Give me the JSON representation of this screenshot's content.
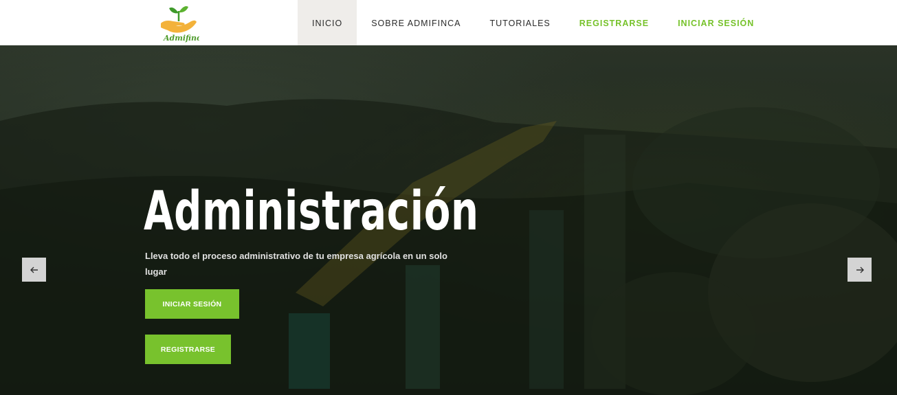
{
  "brand": {
    "logo_text": "Admifinca",
    "logo_colors": {
      "leaf": "#3f9a2b",
      "hand": "#f3b23a"
    }
  },
  "nav": {
    "items": [
      {
        "label": "INICIO",
        "active": true
      },
      {
        "label": "SOBRE ADMIFINCA"
      },
      {
        "label": "TUTORIALES"
      },
      {
        "label": "REGISTRARSE",
        "accent": true
      },
      {
        "label": "INICIAR SESIÓN",
        "accent": true
      }
    ]
  },
  "hero": {
    "title": "Administración",
    "subtitle": "Lleva todo el proceso administrativo de tu empresa agrícola en un solo lugar",
    "buttons": {
      "login": "INICIAR SESIÓN",
      "register": "REGISTRARSE"
    },
    "prev_icon": "arrow-left-icon",
    "next_icon": "arrow-right-icon"
  },
  "colors": {
    "accent": "#78c22d",
    "nav_text": "#2a2a2a",
    "active_bg": "#efedea"
  }
}
